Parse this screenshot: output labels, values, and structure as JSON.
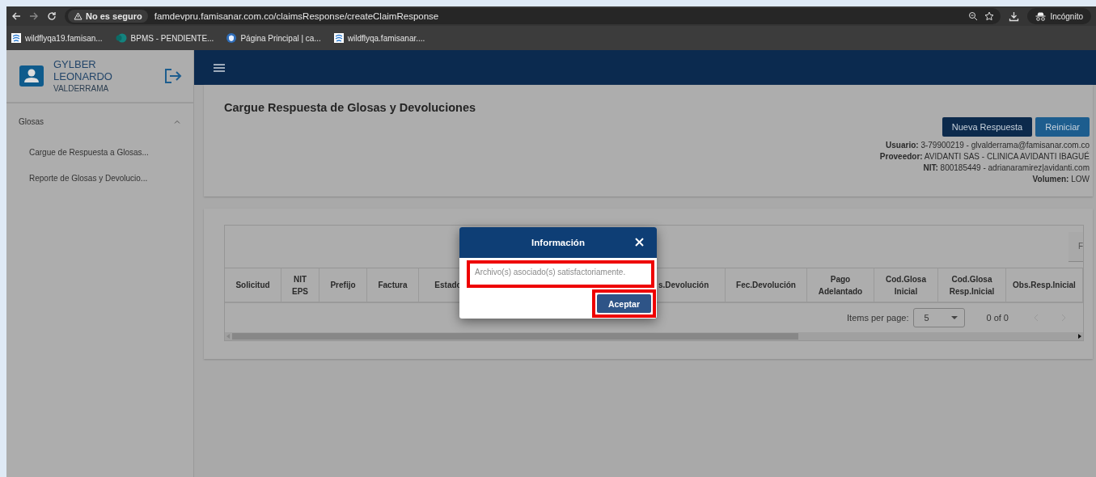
{
  "browser": {
    "security": "No es seguro",
    "url": "famdevpru.famisanar.com.co/claimsResponse/createClaimResponse",
    "profile": "Incógnito",
    "bookmarks": [
      {
        "label": "wildflyqa19.famisan..."
      },
      {
        "label": "BPMS - PENDIENTE..."
      },
      {
        "label": "Página Principal | ca..."
      },
      {
        "label": "wildflyqa.famisanar...."
      }
    ]
  },
  "sidebar": {
    "user_name": [
      "GYLBER",
      "LEONARDO",
      "VALDERRAMA"
    ],
    "menu": [
      {
        "label": "Glosas",
        "expanded": true,
        "children": [
          {
            "label": "Cargue de Respuesta a Glosas..."
          },
          {
            "label": "Reporte de Glosas y Devolucio..."
          }
        ]
      }
    ]
  },
  "page": {
    "title": "Cargue Respuesta de Glosas y Devoluciones",
    "buttons": [
      "Nueva Respuesta",
      "Reiniciar"
    ],
    "info": [
      {
        "label": "Usuario:",
        "value": "3-79900219 - glvalderrama@famisanar.com.co"
      },
      {
        "label": "Proveedor:",
        "value": "AVIDANTI SAS - CLINICA AVIDANTI IBAGUÉ"
      },
      {
        "label": "NIT:",
        "value": "800185449 - adrianaramirez|avidanti.com"
      },
      {
        "label": "Volumen:",
        "value": "LOW"
      }
    ]
  },
  "table": {
    "toolbar_button": "F",
    "columns": [
      "Solicitud",
      "NIT EPS",
      "Prefijo",
      "Factura",
      "Estado",
      "s.Devolución",
      "Fec.Devolución",
      "Pago Adelantado",
      "Cod.Glosa Inicial",
      "Cod.Glosa Resp.Inicial",
      "Obs.Resp.Inicial"
    ],
    "paginator": {
      "label": "Items per page:",
      "page_size": "5",
      "range": "0 of 0"
    }
  },
  "dialog": {
    "title": "Información",
    "message": "Archivo(s) asociado(s) satisfactoriamente.",
    "button": "Aceptar"
  }
}
